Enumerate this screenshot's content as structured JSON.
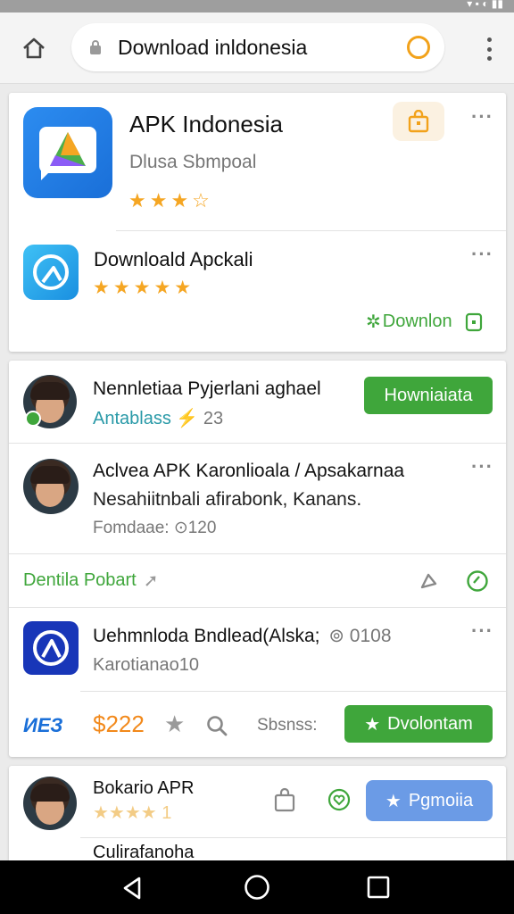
{
  "browser": {
    "url_text": "Download inldonesia"
  },
  "card1": {
    "app1": {
      "title": "APK Indonesia",
      "subtitle": "Dlusa Sbmpoal",
      "stars": "★★★☆"
    },
    "app2": {
      "title": "Downloald Apckali",
      "stars": "★★★★★"
    },
    "download_link": "Downlon"
  },
  "card2": {
    "item1": {
      "title": "Nennletiaa Pyjerlani aghael",
      "subtitle": "Antablass",
      "count": "23",
      "button": "Howniaiata"
    },
    "item2": {
      "title": "Aclvea APK Karonlioala / Apsakarnaa",
      "body": "Nesahiitnbali afirabonk, Kanans.",
      "meta": "Fomdaae: ⊙120"
    },
    "action_left": "Dentila Pobart",
    "item3": {
      "title": "Uehmnloda Bndlead(Alska;",
      "count": "0108",
      "subtitle": "Karotianao10"
    },
    "footer": {
      "brand": "ИЕЗ",
      "price": "$222",
      "label": "Sbsnss:",
      "button": "Dvolontam"
    }
  },
  "card3": {
    "item1": {
      "title": "Bokario APR",
      "rating": "★★★★ 1",
      "button": "Pgmoiia"
    },
    "item2": {
      "title": "Culirafanoha"
    }
  },
  "colors": {
    "accent_green": "#3fa63b",
    "accent_orange": "#f2a21b",
    "accent_blue": "#6b9be6",
    "star": "#f5a623"
  }
}
